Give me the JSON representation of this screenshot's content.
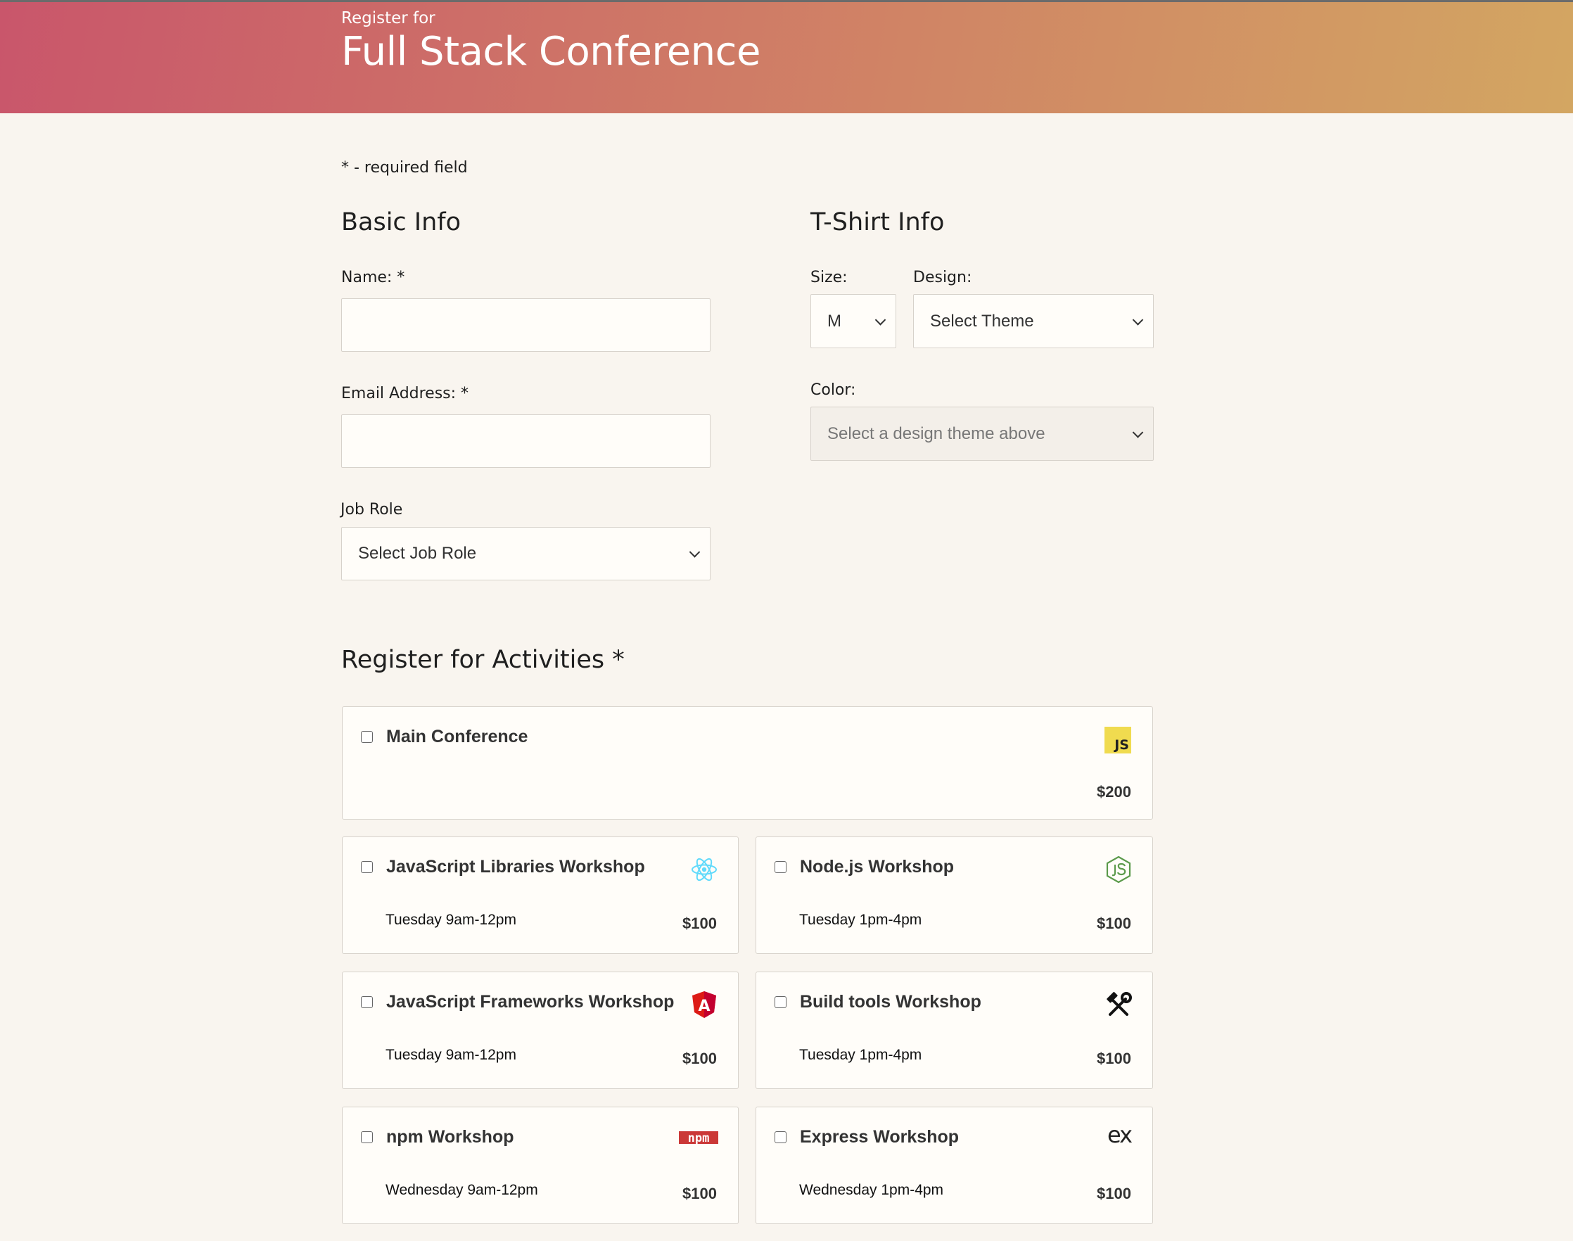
{
  "header": {
    "pre": "Register for",
    "title": "Full Stack Conference"
  },
  "required_note": "* - required field",
  "basic_info": {
    "heading": "Basic Info",
    "name_label": "Name: *",
    "email_label": "Email Address: *",
    "job_role_label": "Job Role",
    "job_role_value": "Select Job Role"
  },
  "tshirt": {
    "heading": "T-Shirt Info",
    "size_label": "Size:",
    "size_value": "M",
    "design_label": "Design:",
    "design_value": "Select Theme",
    "color_label": "Color:",
    "color_value": "Select a design theme above"
  },
  "activities": {
    "heading": "Register for Activities *",
    "main": {
      "name": "Main Conference",
      "cost": "$200",
      "icon": "js-icon"
    },
    "items": [
      {
        "name": "JavaScript Libraries Workshop",
        "time": "Tuesday 9am-12pm",
        "cost": "$100",
        "icon": "react-icon"
      },
      {
        "name": "Node.js Workshop",
        "time": "Tuesday 1pm-4pm",
        "cost": "$100",
        "icon": "nodejs-icon"
      },
      {
        "name": "JavaScript Frameworks Workshop",
        "time": "Tuesday 9am-12pm",
        "cost": "$100",
        "icon": "angular-icon"
      },
      {
        "name": "Build tools Workshop",
        "time": "Tuesday 1pm-4pm",
        "cost": "$100",
        "icon": "tools-icon"
      },
      {
        "name": "npm Workshop",
        "time": "Wednesday 9am-12pm",
        "cost": "$100",
        "icon": "npm-icon"
      },
      {
        "name": "Express Workshop",
        "time": "Wednesday 1pm-4pm",
        "cost": "$100",
        "icon": "express-icon"
      }
    ],
    "js_badge_text": "JS",
    "npm_text": "npm",
    "express_text": "ex",
    "angular_text": "A"
  },
  "colors": {
    "header_start": "#c9566b",
    "header_end": "#d3a662",
    "background": "#f9f5ef",
    "react": "#61dafb",
    "node": "#5b9a4b",
    "angular": "#dd1b16",
    "npm": "#cb3837",
    "js": "#f0db4f"
  }
}
